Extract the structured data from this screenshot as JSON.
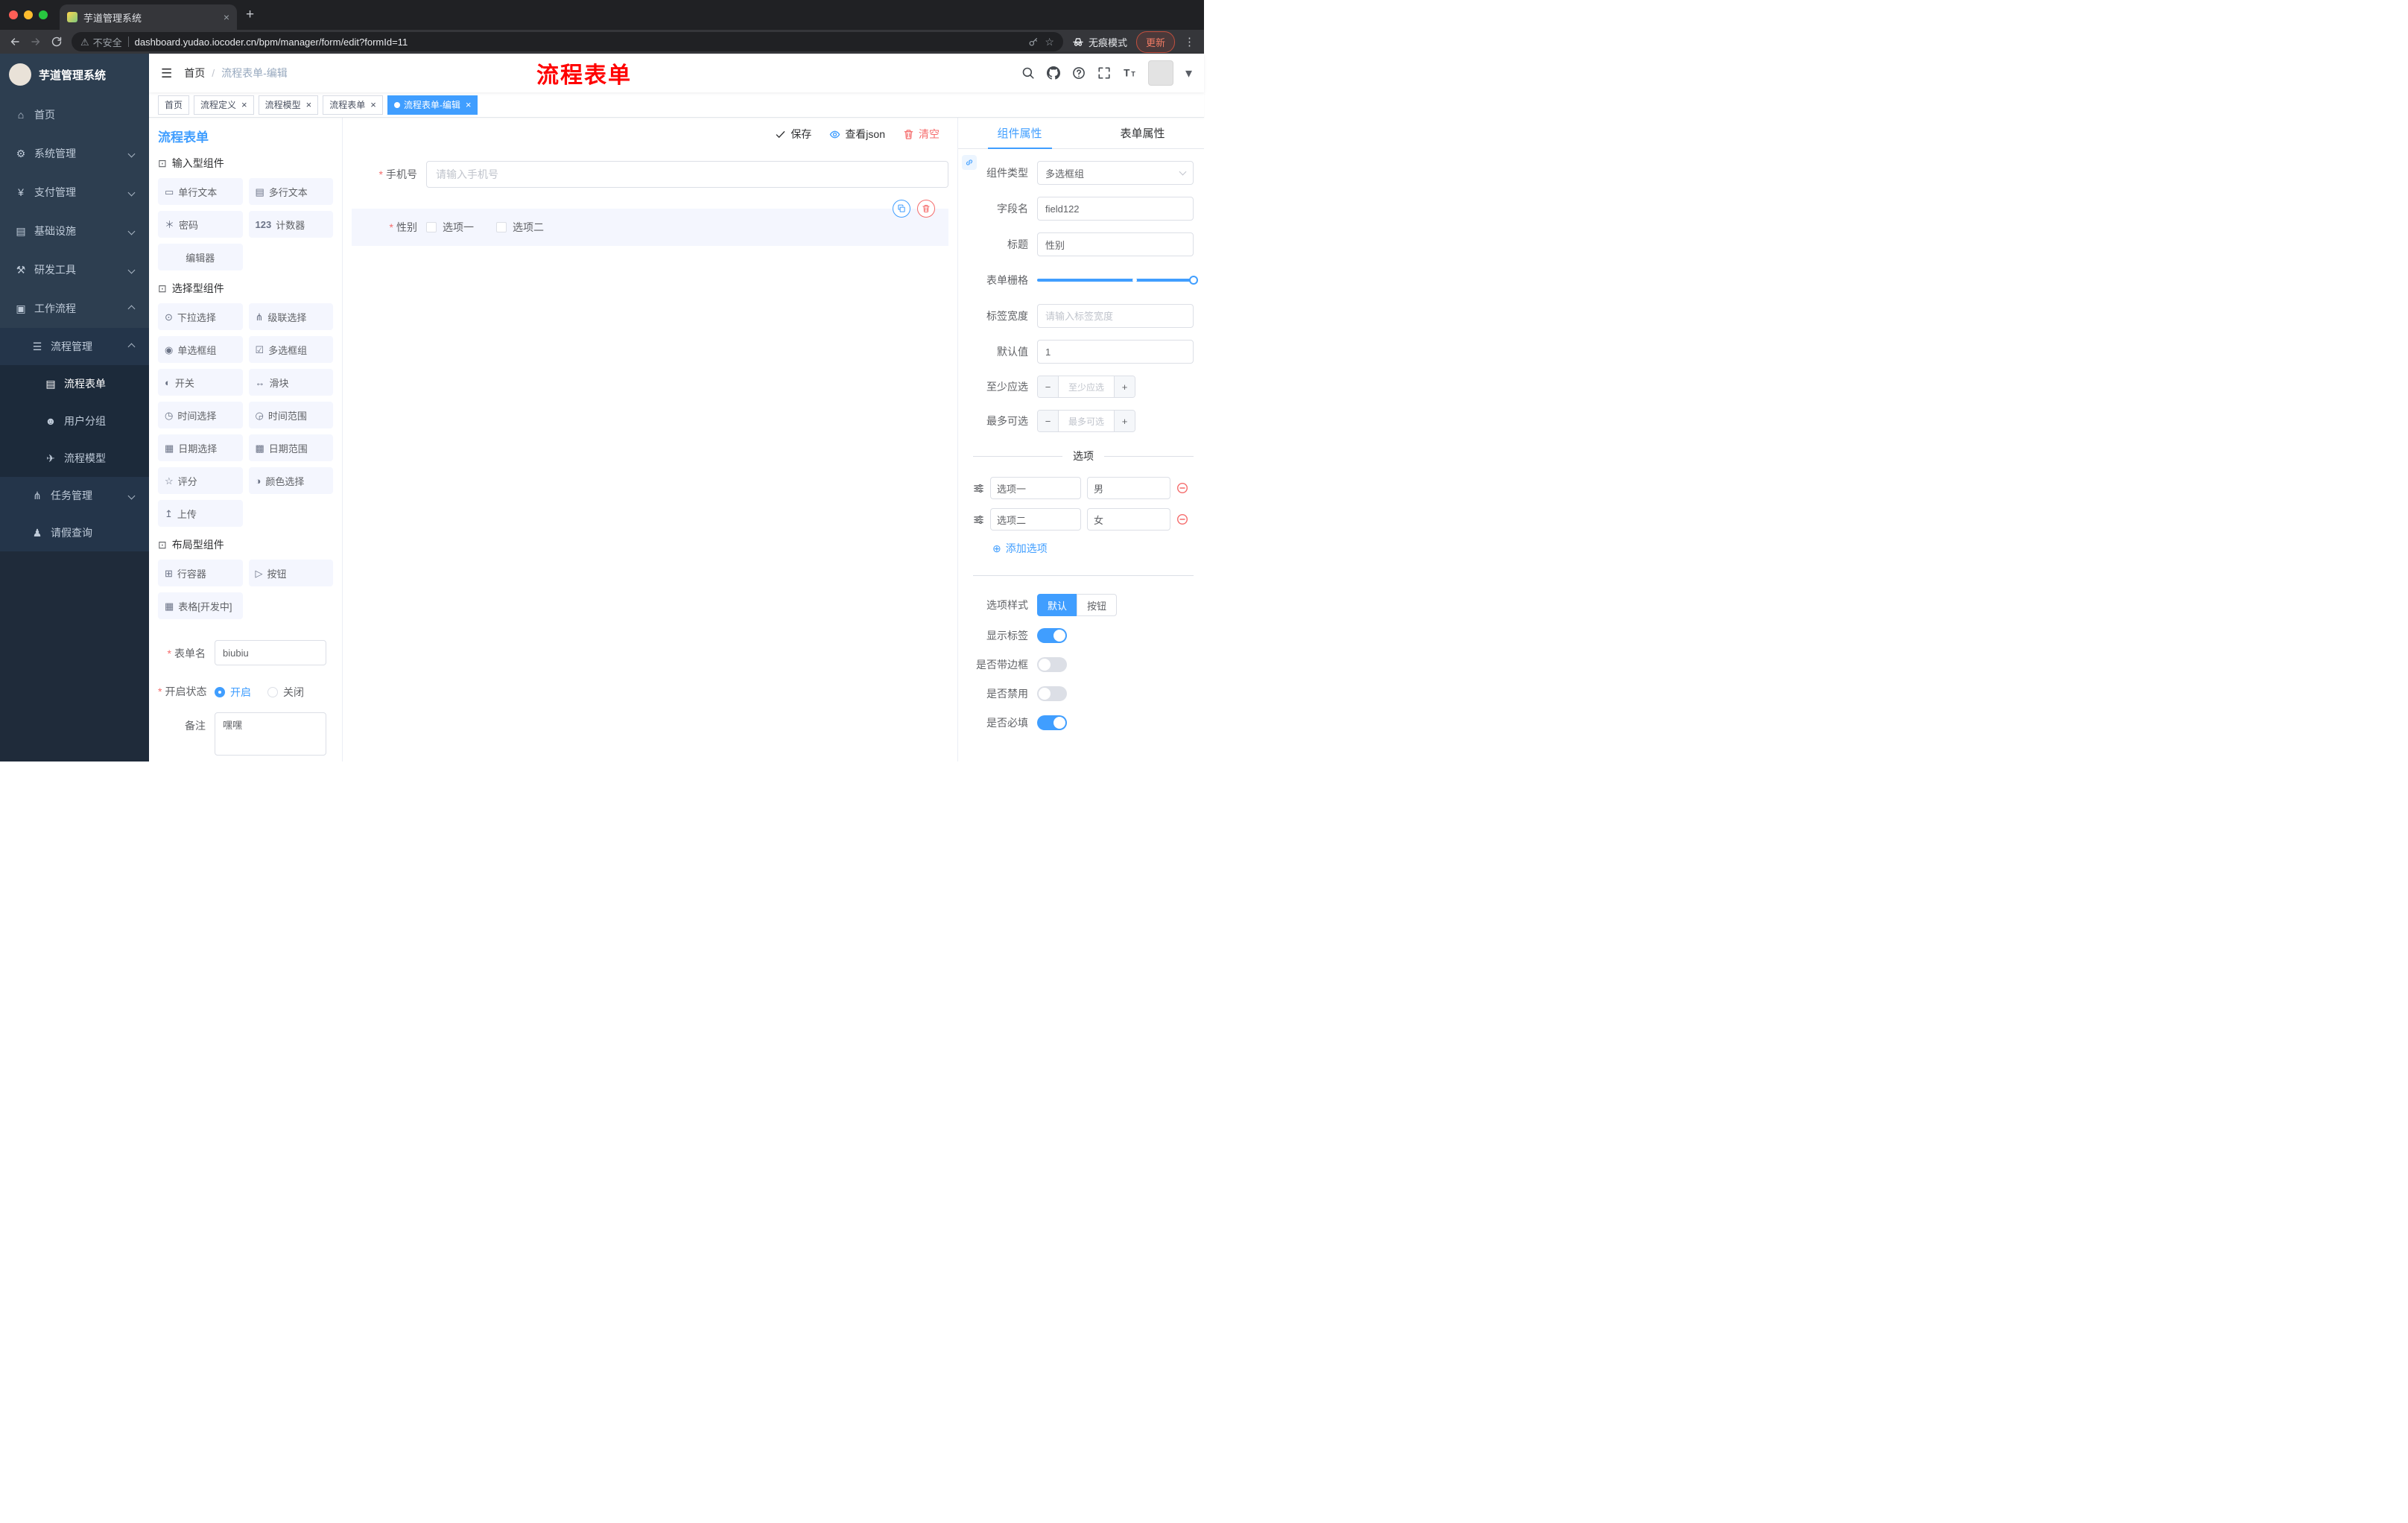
{
  "chrome": {
    "tab_title": "芋道管理系统",
    "security": "不安全",
    "url": "dashboard.yudao.iocoder.cn/bpm/manager/form/edit?formId=11",
    "incognito": "无痕模式",
    "update": "更新"
  },
  "sidebar": {
    "title": "芋道管理系统",
    "menu": [
      {
        "key": "home",
        "label": "首页",
        "icon": "home-icon",
        "level": 1
      },
      {
        "key": "system",
        "label": "系统管理",
        "icon": "gear-icon",
        "level": 1,
        "chevron": "down"
      },
      {
        "key": "payment",
        "label": "支付管理",
        "icon": "yen-icon",
        "level": 1,
        "chevron": "down"
      },
      {
        "key": "infra",
        "label": "基础设施",
        "icon": "infra-icon",
        "level": 1,
        "chevron": "down"
      },
      {
        "key": "devtools",
        "label": "研发工具",
        "icon": "tools-icon",
        "level": 1,
        "chevron": "down"
      },
      {
        "key": "workflow",
        "label": "工作流程",
        "icon": "workflow-icon",
        "level": 1,
        "chevron": "up"
      },
      {
        "key": "process-mgmt",
        "label": "流程管理",
        "icon": "list-icon",
        "level": 2,
        "chevron": "up"
      },
      {
        "key": "process-form",
        "label": "流程表单",
        "icon": "form-icon",
        "level": 3,
        "active": true
      },
      {
        "key": "user-group",
        "label": "用户分组",
        "icon": "users-icon",
        "level": 3
      },
      {
        "key": "process-model",
        "label": "流程模型",
        "icon": "send-icon",
        "level": 3
      },
      {
        "key": "task-mgmt",
        "label": "任务管理",
        "icon": "tree-icon",
        "level": 2,
        "chevron": "down"
      },
      {
        "key": "leave-query",
        "label": "请假查询",
        "icon": "user-icon",
        "level": 2
      }
    ]
  },
  "header": {
    "breadcrumb": [
      "首页",
      "流程表单-编辑"
    ],
    "overlay_title": "流程表单"
  },
  "tags": [
    {
      "key": "home",
      "label": "首页",
      "closable": false,
      "active": false
    },
    {
      "key": "process-definition",
      "label": "流程定义",
      "closable": true,
      "active": false
    },
    {
      "key": "process-model",
      "label": "流程模型",
      "closable": true,
      "active": false
    },
    {
      "key": "process-form",
      "label": "流程表单",
      "closable": true,
      "active": false
    },
    {
      "key": "process-form-edit",
      "label": "流程表单-编辑",
      "closable": true,
      "active": true
    }
  ],
  "palette": {
    "title": "流程表单",
    "groups": [
      {
        "title": "输入型组件",
        "items": [
          {
            "key": "single-text",
            "label": "单行文本",
            "icon": "input-icon"
          },
          {
            "key": "multi-text",
            "label": "多行文本",
            "icon": "textarea-icon"
          },
          {
            "key": "password",
            "label": "密码",
            "icon": "password-icon"
          },
          {
            "key": "counter",
            "label": "计数器",
            "icon": "counter-icon"
          },
          {
            "key": "editor",
            "label": "编辑器",
            "icon": ""
          }
        ]
      },
      {
        "title": "选择型组件",
        "items": [
          {
            "key": "select",
            "label": "下拉选择",
            "icon": "select-icon"
          },
          {
            "key": "cascader",
            "label": "级联选择",
            "icon": "cascader-icon"
          },
          {
            "key": "radio-group",
            "label": "单选框组",
            "icon": "radio-icon"
          },
          {
            "key": "checkbox-group",
            "label": "多选框组",
            "icon": "checkbox-icon"
          },
          {
            "key": "switch",
            "label": "开关",
            "icon": "switch-icon"
          },
          {
            "key": "slider",
            "label": "滑块",
            "icon": "slider-icon"
          },
          {
            "key": "time",
            "label": "时间选择",
            "icon": "time-icon"
          },
          {
            "key": "time-range",
            "label": "时间范围",
            "icon": "time-range-icon"
          },
          {
            "key": "date",
            "label": "日期选择",
            "icon": "date-icon"
          },
          {
            "key": "date-range",
            "label": "日期范围",
            "icon": "date-range-icon"
          },
          {
            "key": "rate",
            "label": "评分",
            "icon": "rate-icon"
          },
          {
            "key": "color",
            "label": "颜色选择",
            "icon": "color-icon"
          },
          {
            "key": "upload",
            "label": "上传",
            "icon": "upload-icon"
          }
        ]
      },
      {
        "title": "布局型组件",
        "items": [
          {
            "key": "row",
            "label": "行容器",
            "icon": "row-icon"
          },
          {
            "key": "button",
            "label": "按钮",
            "icon": "button-icon"
          },
          {
            "key": "table",
            "label": "表格[开发中]",
            "icon": "table-icon"
          }
        ]
      }
    ],
    "form": {
      "name_label": "表单名",
      "name_value": "biubiu",
      "status_label": "开启状态",
      "status_on": "开启",
      "status_off": "关闭",
      "status_value": "开启",
      "remark_label": "备注",
      "remark_value": "嘿嘿"
    }
  },
  "canvas": {
    "toolbar": [
      {
        "key": "save",
        "label": "保存",
        "icon": "check-icon"
      },
      {
        "key": "view-json",
        "label": "查看json",
        "icon": "eye-icon"
      },
      {
        "key": "clear",
        "label": "清空",
        "icon": "trash-icon"
      }
    ],
    "fields": [
      {
        "label": "手机号",
        "required": true,
        "placeholder": "请输入手机号"
      },
      {
        "label": "性别",
        "required": true,
        "options": [
          "选项一",
          "选项二"
        ],
        "selected": true
      }
    ]
  },
  "props": {
    "tabs": [
      "组件属性",
      "表单属性"
    ],
    "active_tab": "组件属性",
    "rows": [
      {
        "key": "component-type",
        "label": "组件类型",
        "control": "select",
        "value": "多选框组"
      },
      {
        "key": "field-name",
        "label": "字段名",
        "control": "input",
        "value": "field122"
      },
      {
        "key": "title",
        "label": "标题",
        "control": "input",
        "value": "性别"
      },
      {
        "key": "form-grid",
        "label": "表单栅格",
        "control": "slider",
        "value": 24,
        "max": 24,
        "mark": 15
      },
      {
        "key": "label-width",
        "label": "标签宽度",
        "control": "input",
        "placeholder": "请输入标签宽度"
      },
      {
        "key": "default-value",
        "label": "默认值",
        "control": "input",
        "value": "1"
      },
      {
        "key": "min-checked",
        "label": "至少应选",
        "control": "stepper",
        "placeholder": "至少应选"
      },
      {
        "key": "max-checked",
        "label": "最多可选",
        "control": "stepper",
        "placeholder": "最多可选"
      }
    ],
    "options_divider": "选项",
    "options": [
      {
        "label": "选项一",
        "value": "男"
      },
      {
        "label": "选项二",
        "value": "女"
      }
    ],
    "add_option": "添加选项",
    "style_row": {
      "label": "选项样式",
      "options": [
        "默认",
        "按钮"
      ],
      "value": "默认"
    },
    "switches": [
      {
        "key": "show-label",
        "label": "显示标签",
        "on": true
      },
      {
        "key": "border",
        "label": "是否带边框",
        "on": false
      },
      {
        "key": "disabled",
        "label": "是否禁用",
        "on": false
      },
      {
        "key": "required",
        "label": "是否必填",
        "on": true
      }
    ]
  },
  "colors": {
    "primary": "#409eff",
    "danger": "#f56c6c",
    "title_red": "#ff0000",
    "sidebar_bg": "#2d3e50"
  }
}
